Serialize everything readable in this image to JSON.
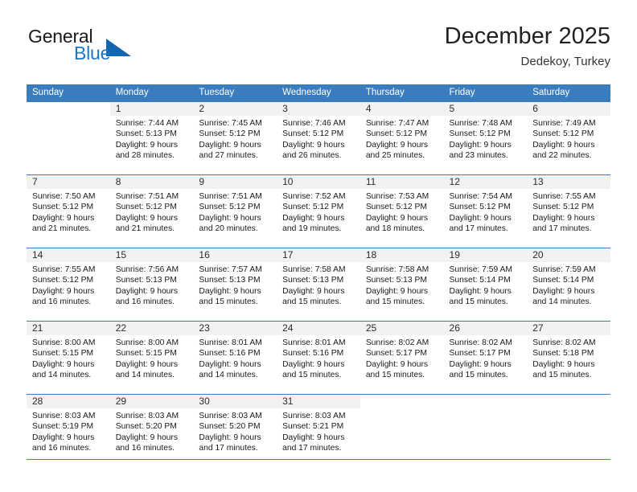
{
  "brand": {
    "name_part1": "General",
    "name_part2": "Blue",
    "triangle_icon": "blue-triangle-icon",
    "accent_color": "#1877c9"
  },
  "header": {
    "title": "December 2025",
    "subtitle": "Dedekoy, Turkey"
  },
  "theme": {
    "header_row_color": "#3a7dbf",
    "daynum_band_color": "#f2f2f2",
    "rule_color": "#3a7dbf"
  },
  "weekdays": [
    "Sunday",
    "Monday",
    "Tuesday",
    "Wednesday",
    "Thursday",
    "Friday",
    "Saturday"
  ],
  "weeks": [
    [
      {
        "day": "",
        "sunrise": "",
        "sunset": "",
        "daylight1": "",
        "daylight2": "",
        "blank": true
      },
      {
        "day": "1",
        "sunrise": "Sunrise: 7:44 AM",
        "sunset": "Sunset: 5:13 PM",
        "daylight1": "Daylight: 9 hours",
        "daylight2": "and 28 minutes."
      },
      {
        "day": "2",
        "sunrise": "Sunrise: 7:45 AM",
        "sunset": "Sunset: 5:12 PM",
        "daylight1": "Daylight: 9 hours",
        "daylight2": "and 27 minutes."
      },
      {
        "day": "3",
        "sunrise": "Sunrise: 7:46 AM",
        "sunset": "Sunset: 5:12 PM",
        "daylight1": "Daylight: 9 hours",
        "daylight2": "and 26 minutes."
      },
      {
        "day": "4",
        "sunrise": "Sunrise: 7:47 AM",
        "sunset": "Sunset: 5:12 PM",
        "daylight1": "Daylight: 9 hours",
        "daylight2": "and 25 minutes."
      },
      {
        "day": "5",
        "sunrise": "Sunrise: 7:48 AM",
        "sunset": "Sunset: 5:12 PM",
        "daylight1": "Daylight: 9 hours",
        "daylight2": "and 23 minutes."
      },
      {
        "day": "6",
        "sunrise": "Sunrise: 7:49 AM",
        "sunset": "Sunset: 5:12 PM",
        "daylight1": "Daylight: 9 hours",
        "daylight2": "and 22 minutes."
      }
    ],
    [
      {
        "day": "7",
        "sunrise": "Sunrise: 7:50 AM",
        "sunset": "Sunset: 5:12 PM",
        "daylight1": "Daylight: 9 hours",
        "daylight2": "and 21 minutes."
      },
      {
        "day": "8",
        "sunrise": "Sunrise: 7:51 AM",
        "sunset": "Sunset: 5:12 PM",
        "daylight1": "Daylight: 9 hours",
        "daylight2": "and 21 minutes."
      },
      {
        "day": "9",
        "sunrise": "Sunrise: 7:51 AM",
        "sunset": "Sunset: 5:12 PM",
        "daylight1": "Daylight: 9 hours",
        "daylight2": "and 20 minutes."
      },
      {
        "day": "10",
        "sunrise": "Sunrise: 7:52 AM",
        "sunset": "Sunset: 5:12 PM",
        "daylight1": "Daylight: 9 hours",
        "daylight2": "and 19 minutes."
      },
      {
        "day": "11",
        "sunrise": "Sunrise: 7:53 AM",
        "sunset": "Sunset: 5:12 PM",
        "daylight1": "Daylight: 9 hours",
        "daylight2": "and 18 minutes."
      },
      {
        "day": "12",
        "sunrise": "Sunrise: 7:54 AM",
        "sunset": "Sunset: 5:12 PM",
        "daylight1": "Daylight: 9 hours",
        "daylight2": "and 17 minutes."
      },
      {
        "day": "13",
        "sunrise": "Sunrise: 7:55 AM",
        "sunset": "Sunset: 5:12 PM",
        "daylight1": "Daylight: 9 hours",
        "daylight2": "and 17 minutes."
      }
    ],
    [
      {
        "day": "14",
        "sunrise": "Sunrise: 7:55 AM",
        "sunset": "Sunset: 5:12 PM",
        "daylight1": "Daylight: 9 hours",
        "daylight2": "and 16 minutes."
      },
      {
        "day": "15",
        "sunrise": "Sunrise: 7:56 AM",
        "sunset": "Sunset: 5:13 PM",
        "daylight1": "Daylight: 9 hours",
        "daylight2": "and 16 minutes."
      },
      {
        "day": "16",
        "sunrise": "Sunrise: 7:57 AM",
        "sunset": "Sunset: 5:13 PM",
        "daylight1": "Daylight: 9 hours",
        "daylight2": "and 15 minutes."
      },
      {
        "day": "17",
        "sunrise": "Sunrise: 7:58 AM",
        "sunset": "Sunset: 5:13 PM",
        "daylight1": "Daylight: 9 hours",
        "daylight2": "and 15 minutes."
      },
      {
        "day": "18",
        "sunrise": "Sunrise: 7:58 AM",
        "sunset": "Sunset: 5:13 PM",
        "daylight1": "Daylight: 9 hours",
        "daylight2": "and 15 minutes."
      },
      {
        "day": "19",
        "sunrise": "Sunrise: 7:59 AM",
        "sunset": "Sunset: 5:14 PM",
        "daylight1": "Daylight: 9 hours",
        "daylight2": "and 15 minutes."
      },
      {
        "day": "20",
        "sunrise": "Sunrise: 7:59 AM",
        "sunset": "Sunset: 5:14 PM",
        "daylight1": "Daylight: 9 hours",
        "daylight2": "and 14 minutes."
      }
    ],
    [
      {
        "day": "21",
        "sunrise": "Sunrise: 8:00 AM",
        "sunset": "Sunset: 5:15 PM",
        "daylight1": "Daylight: 9 hours",
        "daylight2": "and 14 minutes."
      },
      {
        "day": "22",
        "sunrise": "Sunrise: 8:00 AM",
        "sunset": "Sunset: 5:15 PM",
        "daylight1": "Daylight: 9 hours",
        "daylight2": "and 14 minutes."
      },
      {
        "day": "23",
        "sunrise": "Sunrise: 8:01 AM",
        "sunset": "Sunset: 5:16 PM",
        "daylight1": "Daylight: 9 hours",
        "daylight2": "and 14 minutes."
      },
      {
        "day": "24",
        "sunrise": "Sunrise: 8:01 AM",
        "sunset": "Sunset: 5:16 PM",
        "daylight1": "Daylight: 9 hours",
        "daylight2": "and 15 minutes."
      },
      {
        "day": "25",
        "sunrise": "Sunrise: 8:02 AM",
        "sunset": "Sunset: 5:17 PM",
        "daylight1": "Daylight: 9 hours",
        "daylight2": "and 15 minutes."
      },
      {
        "day": "26",
        "sunrise": "Sunrise: 8:02 AM",
        "sunset": "Sunset: 5:17 PM",
        "daylight1": "Daylight: 9 hours",
        "daylight2": "and 15 minutes."
      },
      {
        "day": "27",
        "sunrise": "Sunrise: 8:02 AM",
        "sunset": "Sunset: 5:18 PM",
        "daylight1": "Daylight: 9 hours",
        "daylight2": "and 15 minutes."
      }
    ],
    [
      {
        "day": "28",
        "sunrise": "Sunrise: 8:03 AM",
        "sunset": "Sunset: 5:19 PM",
        "daylight1": "Daylight: 9 hours",
        "daylight2": "and 16 minutes."
      },
      {
        "day": "29",
        "sunrise": "Sunrise: 8:03 AM",
        "sunset": "Sunset: 5:20 PM",
        "daylight1": "Daylight: 9 hours",
        "daylight2": "and 16 minutes."
      },
      {
        "day": "30",
        "sunrise": "Sunrise: 8:03 AM",
        "sunset": "Sunset: 5:20 PM",
        "daylight1": "Daylight: 9 hours",
        "daylight2": "and 17 minutes."
      },
      {
        "day": "31",
        "sunrise": "Sunrise: 8:03 AM",
        "sunset": "Sunset: 5:21 PM",
        "daylight1": "Daylight: 9 hours",
        "daylight2": "and 17 minutes."
      },
      {
        "day": "",
        "sunrise": "",
        "sunset": "",
        "daylight1": "",
        "daylight2": "",
        "blank": true
      },
      {
        "day": "",
        "sunrise": "",
        "sunset": "",
        "daylight1": "",
        "daylight2": "",
        "blank": true
      },
      {
        "day": "",
        "sunrise": "",
        "sunset": "",
        "daylight1": "",
        "daylight2": "",
        "blank": true
      }
    ]
  ]
}
